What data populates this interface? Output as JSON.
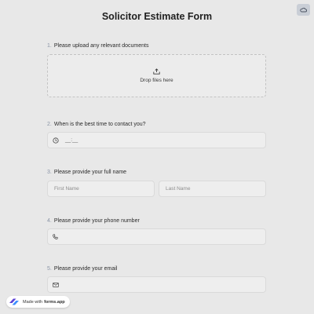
{
  "form": {
    "title": "Solicitor Estimate Form"
  },
  "questions": [
    {
      "number": "1.",
      "label": "Please upload any relevant documents",
      "dropzone_text": "Drop files here"
    },
    {
      "number": "2.",
      "label": "When is the best time to contact you?",
      "time_value": "__:__"
    },
    {
      "number": "3.",
      "label": "Please provide your full name",
      "first_placeholder": "First Name",
      "last_placeholder": "Last Name"
    },
    {
      "number": "4.",
      "label": "Please provide your phone number"
    },
    {
      "number": "5.",
      "label": "Please provide your email"
    }
  ],
  "badge": {
    "prefix": "Made with",
    "brand": "forms.app"
  },
  "icons": {
    "corner": "cloud-icon",
    "upload": "upload-icon",
    "time": "clock-icon",
    "phone": "phone-icon",
    "email": "envelope-icon",
    "badge_logo": "forms-app-logo"
  },
  "colors": {
    "background": "#e8e8e8",
    "field_bg": "#eeeeee",
    "number": "#8a94a6",
    "logo": "#5b3fd6"
  }
}
